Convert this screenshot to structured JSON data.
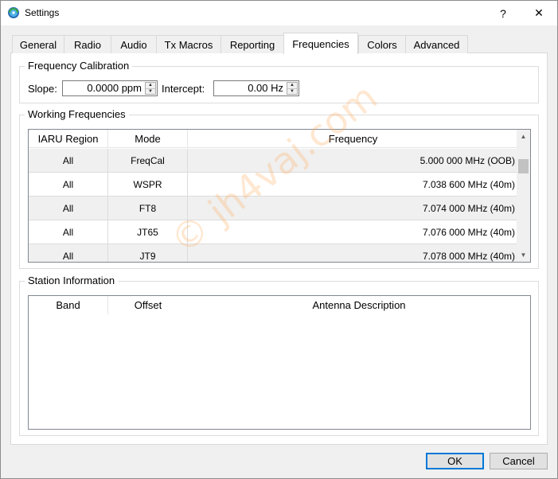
{
  "window": {
    "title": "Settings",
    "help_label": "?",
    "close_label": "✕"
  },
  "tabs": [
    {
      "label": "General"
    },
    {
      "label": "Radio"
    },
    {
      "label": "Audio"
    },
    {
      "label": "Tx Macros"
    },
    {
      "label": "Reporting"
    },
    {
      "label": "Frequencies",
      "active": true
    },
    {
      "label": "Colors"
    },
    {
      "label": "Advanced"
    }
  ],
  "calibration": {
    "title": "Frequency Calibration",
    "slope_label": "Slope:",
    "slope_value": "0.0000 ppm",
    "intercept_label": "Intercept:",
    "intercept_value": "0.00 Hz"
  },
  "working_frequencies": {
    "title": "Working Frequencies",
    "columns": [
      "IARU Region",
      "Mode",
      "Frequency"
    ],
    "sort_indicator": "^",
    "rows": [
      {
        "region": "All",
        "mode": "FreqCal",
        "frequency": "5.000 000 MHz (OOB)"
      },
      {
        "region": "All",
        "mode": "WSPR",
        "frequency": "7.038 600 MHz (40m)"
      },
      {
        "region": "All",
        "mode": "FT8",
        "frequency": "7.074 000 MHz (40m)"
      },
      {
        "region": "All",
        "mode": "JT65",
        "frequency": "7.076 000 MHz (40m)"
      },
      {
        "region": "All",
        "mode": "JT9",
        "frequency": "7.078 000 MHz (40m)"
      }
    ]
  },
  "station": {
    "title": "Station Information",
    "columns": [
      "Band",
      "Offset",
      "Antenna Description"
    ],
    "sort_indicator": "^"
  },
  "buttons": {
    "ok": "OK",
    "cancel": "Cancel"
  },
  "icons": {
    "app": "wsjtx-app-icon",
    "scroll_up": "▲",
    "scroll_down": "▼",
    "spin_up": "▲",
    "spin_down": "▼"
  },
  "watermark": "© jh4vaj.com",
  "colors": {
    "accent": "#0078d7",
    "alt_row": "#f0f0f0"
  }
}
